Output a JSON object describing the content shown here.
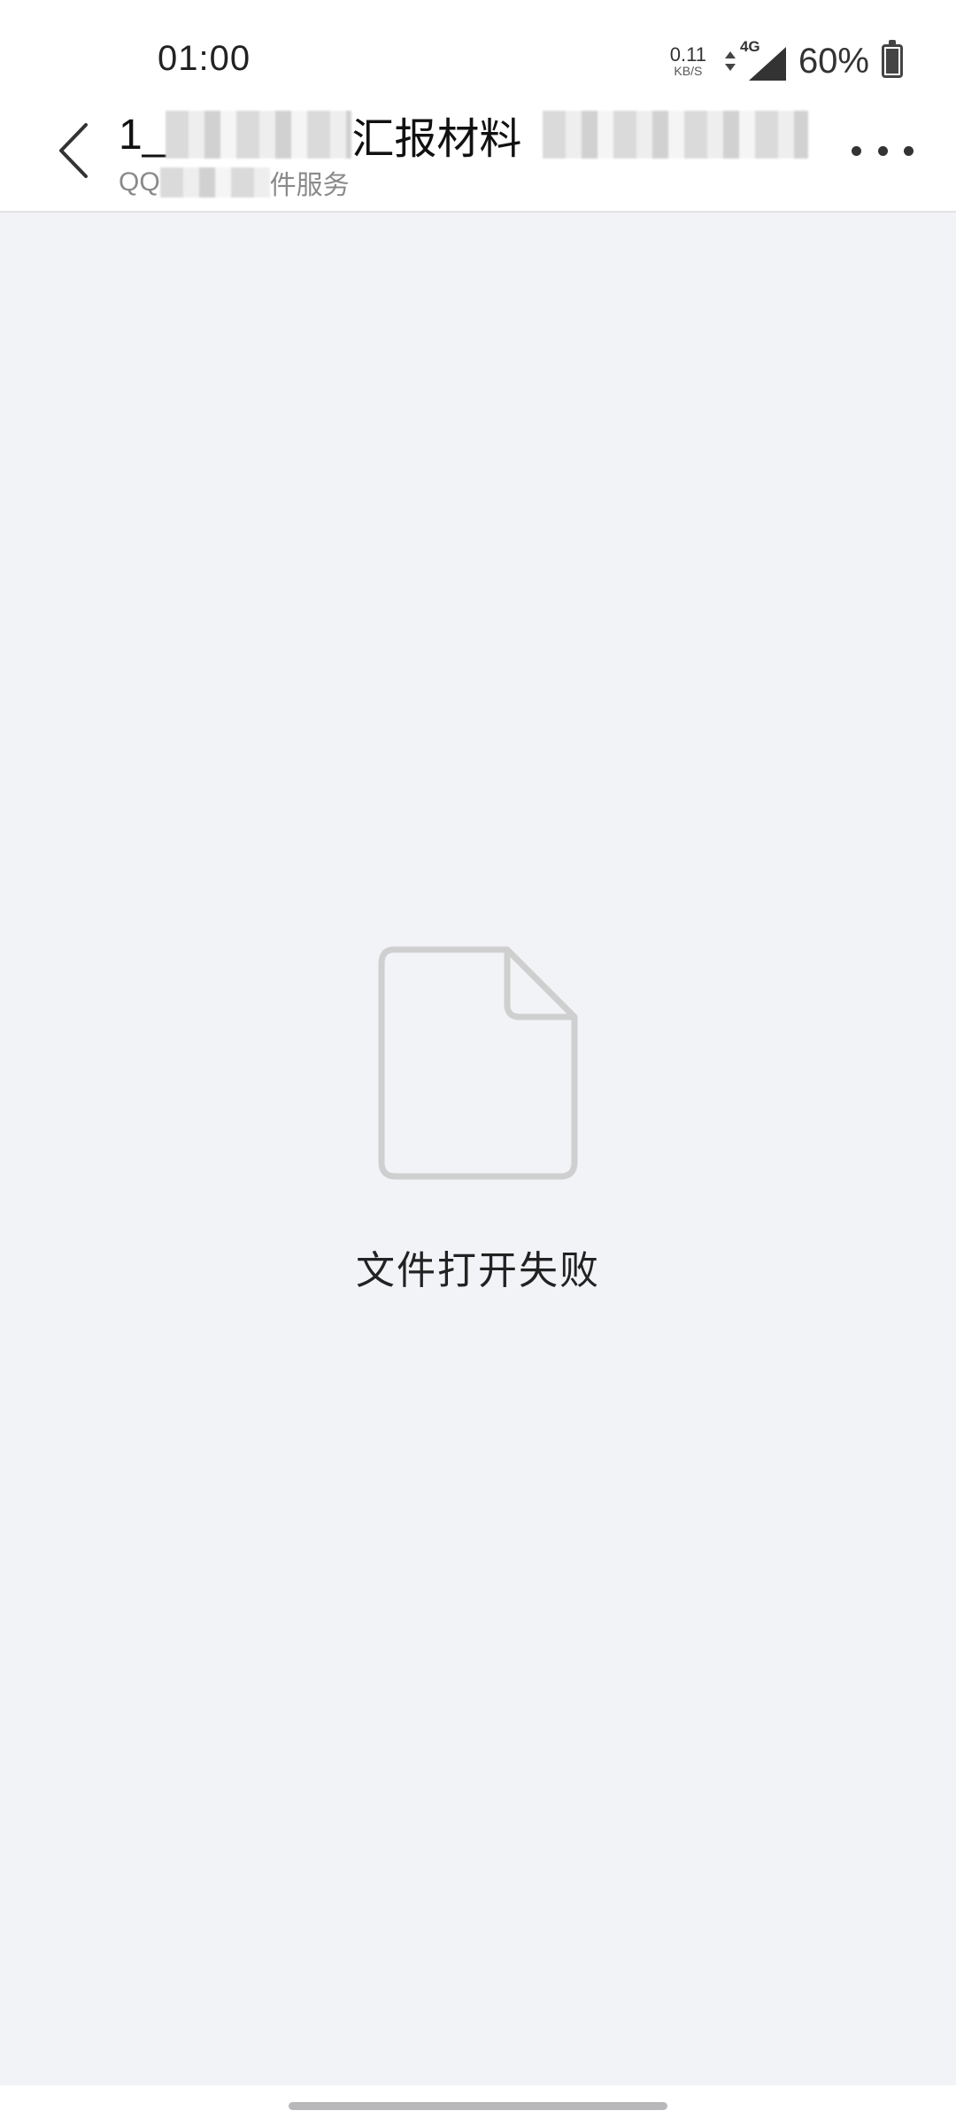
{
  "status_bar": {
    "time": "01:00",
    "net_speed_value": "0.11",
    "net_speed_unit": "KB/S",
    "network_type": "4G",
    "battery_percent": "60%",
    "battery_level": 0.6
  },
  "header": {
    "title_prefix": "1_",
    "title_visible_part": "汇报材料",
    "subtitle_prefix": "QQ",
    "subtitle_suffix": "件服务",
    "back_icon": "chevron-left-icon",
    "more_icon": "more-horizontal-icon"
  },
  "empty_state": {
    "icon": "file-icon",
    "message": "文件打开失败"
  },
  "colors": {
    "background": "#f2f3f7",
    "header_bg": "#ffffff",
    "icon_gray": "#cfcfcf",
    "text_primary": "#222222",
    "text_secondary": "#8a8a8a"
  }
}
